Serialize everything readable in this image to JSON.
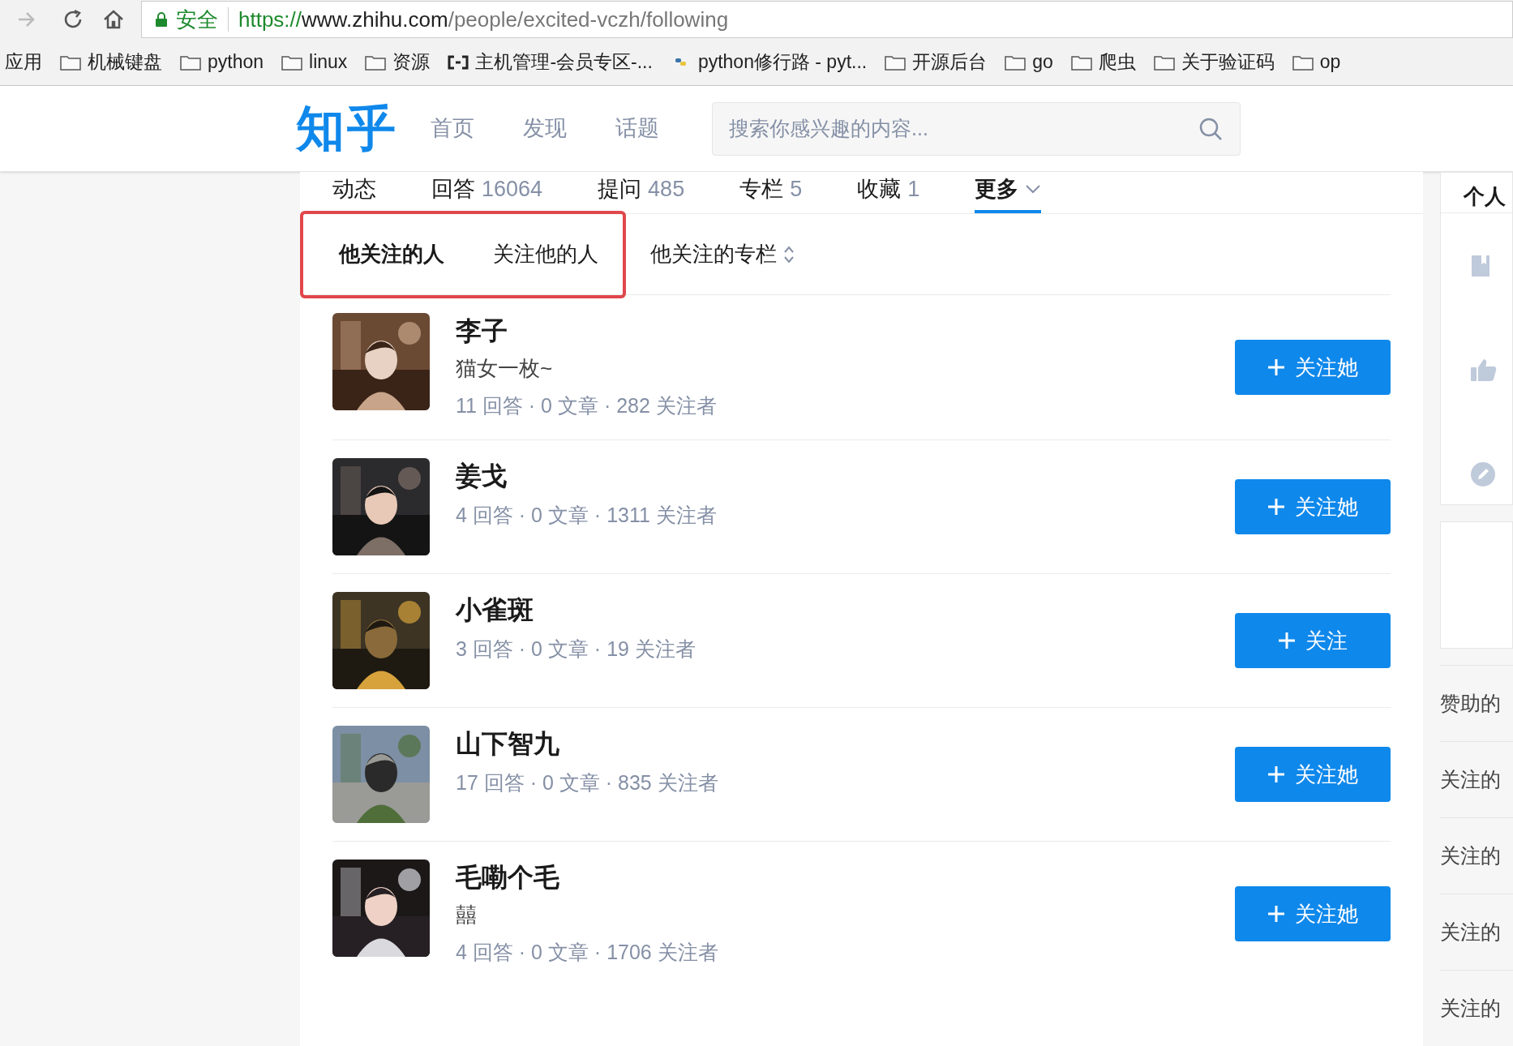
{
  "browser": {
    "secure_label": "安全",
    "url_scheme": "https://",
    "url_host": "www.zhihu.com",
    "url_path": "/people/excited-vczh/following"
  },
  "bookmarks": [
    {
      "label": "应用",
      "kind": "apps"
    },
    {
      "label": "机械键盘",
      "kind": "folder"
    },
    {
      "label": "python",
      "kind": "folder"
    },
    {
      "label": "linux",
      "kind": "folder"
    },
    {
      "label": "资源",
      "kind": "folder"
    },
    {
      "label": "主机管理-会员专区-...",
      "kind": "cloud"
    },
    {
      "label": "python修行路 - pyt...",
      "kind": "site"
    },
    {
      "label": "开源后台",
      "kind": "folder"
    },
    {
      "label": "go",
      "kind": "folder"
    },
    {
      "label": "爬虫",
      "kind": "folder"
    },
    {
      "label": "关于验证码",
      "kind": "folder"
    },
    {
      "label": "op",
      "kind": "folder"
    }
  ],
  "header": {
    "logo": "知乎",
    "nav": [
      "首页",
      "发现",
      "话题"
    ],
    "search": {
      "placeholder": "搜索你感兴趣的内容..."
    }
  },
  "profile_tabs": [
    {
      "label": "动态",
      "selected": false
    },
    {
      "label": "回答",
      "count": "16064",
      "selected": false
    },
    {
      "label": "提问",
      "count": "485",
      "selected": false
    },
    {
      "label": "专栏",
      "count": "5",
      "selected": false
    },
    {
      "label": "收藏",
      "count": "1",
      "selected": false
    },
    {
      "label": "更多",
      "selected": true,
      "dropdown": true
    }
  ],
  "sub_tabs": [
    {
      "label": "他关注的人",
      "selected": true,
      "annotated": true
    },
    {
      "label": "关注他的人",
      "selected": false,
      "annotated": true
    },
    {
      "label": "他关注的专栏",
      "selected": false,
      "annotated": false,
      "sortable": true
    }
  ],
  "users": [
    {
      "name": "李子",
      "bio": "猫女一枚~",
      "stats": "11 回答 · 0 文章 · 282 关注者",
      "button": "关注她"
    },
    {
      "name": "姜戈",
      "stats": "4 回答 · 0 文章 · 1311 关注者",
      "button": "关注她"
    },
    {
      "name": "小雀斑",
      "stats": "3 回答 · 0 文章 · 19 关注者",
      "button": "关注"
    },
    {
      "name": "山下智九",
      "stats": "17 回答 · 0 文章 · 835 关注者",
      "button": "关注她"
    },
    {
      "name": "毛嘞个毛",
      "bio": "囍",
      "stats": "4 回答 · 0 文章 · 1706 关注者",
      "button": "关注她"
    }
  ],
  "sidebar": {
    "title": "个人",
    "links": [
      "赞助的",
      "关注的",
      "关注的",
      "关注的",
      "关注的"
    ]
  }
}
